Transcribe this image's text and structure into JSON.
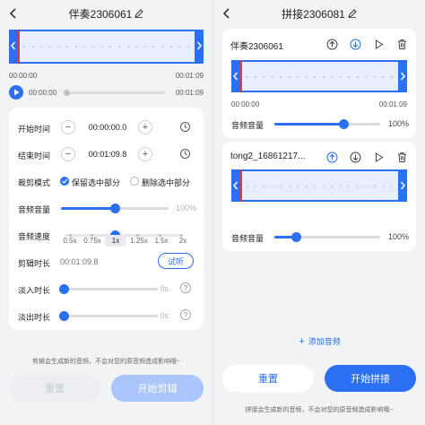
{
  "left": {
    "title": "伴奏2306061",
    "time_start": "00:00:00",
    "time_end": "00:01:09",
    "play_time_start": "00:00:00",
    "play_time_end": "00:01:09",
    "start_label": "开始时间",
    "start_value": "00:00:00.0",
    "end_label": "结束时间",
    "end_value": "00:01:09.8",
    "mode_label": "裁剪模式",
    "mode_keep": "保留选中部分",
    "mode_delete": "删除选中部分",
    "volume_label": "音频音量",
    "volume_value": "100%",
    "volume_level": 0.5,
    "speed_label": "音频速度",
    "speeds": [
      "0.5x",
      "0.75x",
      "1x",
      "1.25x",
      "1.5x",
      "2x"
    ],
    "speed_selected": "1x",
    "duration_label": "剪辑时长",
    "duration_value": "00:01:09.8",
    "listen_button": "试听",
    "fadein_label": "淡入时长",
    "fadein_value": "0s",
    "fadeout_label": "淡出时长",
    "fadeout_value": "0s",
    "note": "剪辑会生成新的音频，不会对您的原音频造成影响哦~",
    "reset_button": "重置",
    "start_clip_button": "开始剪辑"
  },
  "right": {
    "title": "拼接2306081",
    "tracks": [
      {
        "name": "伴奏2306061",
        "time_start": "00:00:00",
        "time_end": "00:01:09",
        "volume_label": "音频音量",
        "volume_value": "100%",
        "volume_level": 0.65
      },
      {
        "name": "tong2_16861217...",
        "time_start": "00:00:00",
        "time_end": "00:01:09",
        "volume_label": "音频音量",
        "volume_value": "100%",
        "volume_level": 0.2
      }
    ],
    "add_audio": "添加音频",
    "reset_button": "重置",
    "start_join_button": "开始拼接",
    "note": "拼接会生成新的音频，不会对您的原音频造成影响哦~"
  },
  "icons": {
    "back": "back-arrow-icon",
    "edit": "edit-pencil-icon",
    "play": "play-icon",
    "clock": "history-clock-icon",
    "up": "move-up-icon",
    "down": "move-down-icon",
    "delete": "trash-icon",
    "help": "help-icon",
    "add": "plus-icon"
  },
  "colors": {
    "accent": "#2b6ff3",
    "playhead": "#e53935"
  }
}
